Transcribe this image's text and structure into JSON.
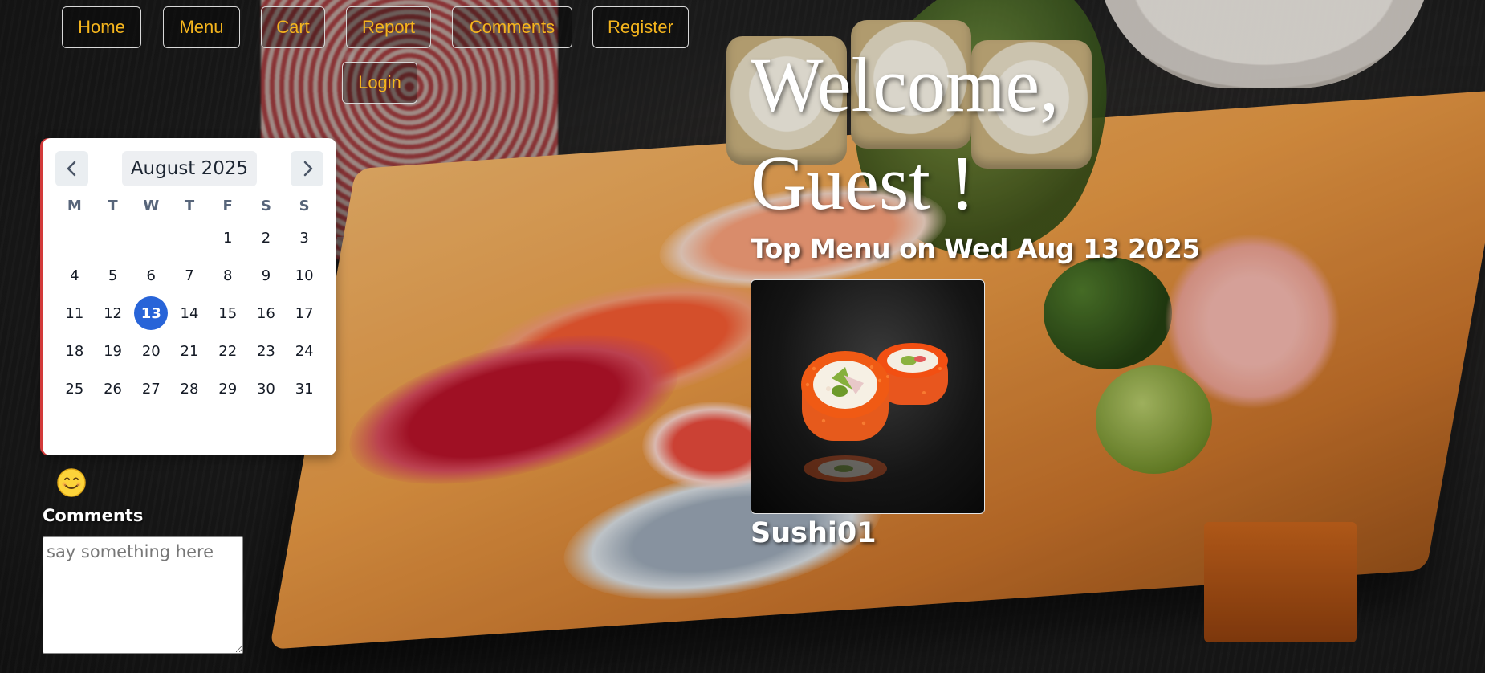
{
  "nav": {
    "items": [
      {
        "label": "Home"
      },
      {
        "label": "Menu"
      },
      {
        "label": "Cart"
      },
      {
        "label": "Report"
      },
      {
        "label": "Comments"
      },
      {
        "label": "Register"
      },
      {
        "label": "Login"
      }
    ],
    "text_color": "#f5b51d"
  },
  "calendar": {
    "month_label": "August 2025",
    "prev_icon": "chevron-left-icon",
    "next_icon": "chevron-right-icon",
    "weekdays": [
      "M",
      "T",
      "W",
      "T",
      "F",
      "S",
      "S"
    ],
    "weeks": [
      [
        "",
        "",
        "",
        "",
        "1",
        "2",
        "3"
      ],
      [
        "4",
        "5",
        "6",
        "7",
        "8",
        "9",
        "10"
      ],
      [
        "11",
        "12",
        "13",
        "14",
        "15",
        "16",
        "17"
      ],
      [
        "18",
        "19",
        "20",
        "21",
        "22",
        "23",
        "24"
      ],
      [
        "25",
        "26",
        "27",
        "28",
        "29",
        "30",
        "31"
      ]
    ],
    "selected_day": "13",
    "selected_color": "#2864d8"
  },
  "comments": {
    "emoji": "😊",
    "label": "Comments",
    "placeholder": "say something here"
  },
  "welcome": {
    "line1": "Welcome,",
    "line2": "Guest !"
  },
  "top_menu": {
    "heading": "Top Menu on Wed Aug 13 2025",
    "item_name": "Sushi01"
  }
}
